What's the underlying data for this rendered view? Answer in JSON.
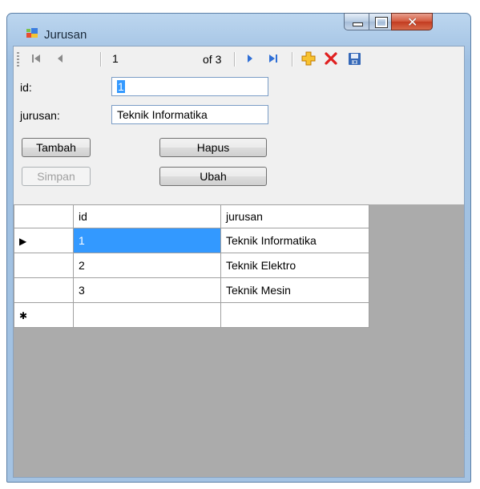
{
  "window": {
    "title": "Jurusan",
    "icon": "form-app-icon"
  },
  "navigator": {
    "position": "1",
    "of_label": "of 3",
    "icons": [
      "move-first-icon",
      "move-previous-icon",
      "move-next-icon",
      "move-last-icon",
      "add-new-icon",
      "delete-icon",
      "save-icon"
    ]
  },
  "form": {
    "id_label": "id:",
    "id_value": "1",
    "jurusan_label": "jurusan:",
    "jurusan_value": "Teknik Informatika"
  },
  "buttons": {
    "tambah": "Tambah",
    "hapus": "Hapus",
    "simpan": "Simpan",
    "ubah": "Ubah"
  },
  "grid": {
    "columns": [
      "id",
      "jurusan"
    ],
    "rows": [
      {
        "marker": "▶",
        "id": "1",
        "jurusan": "Teknik Informatika"
      },
      {
        "marker": "",
        "id": "2",
        "jurusan": "Teknik Elektro"
      },
      {
        "marker": "",
        "id": "3",
        "jurusan": "Teknik Mesin"
      }
    ],
    "new_row_marker": "✱"
  },
  "colors": {
    "selection": "#3399ff",
    "grid_background": "#ababab",
    "delete_red": "#e02020",
    "add_orange": "#f2a900"
  }
}
